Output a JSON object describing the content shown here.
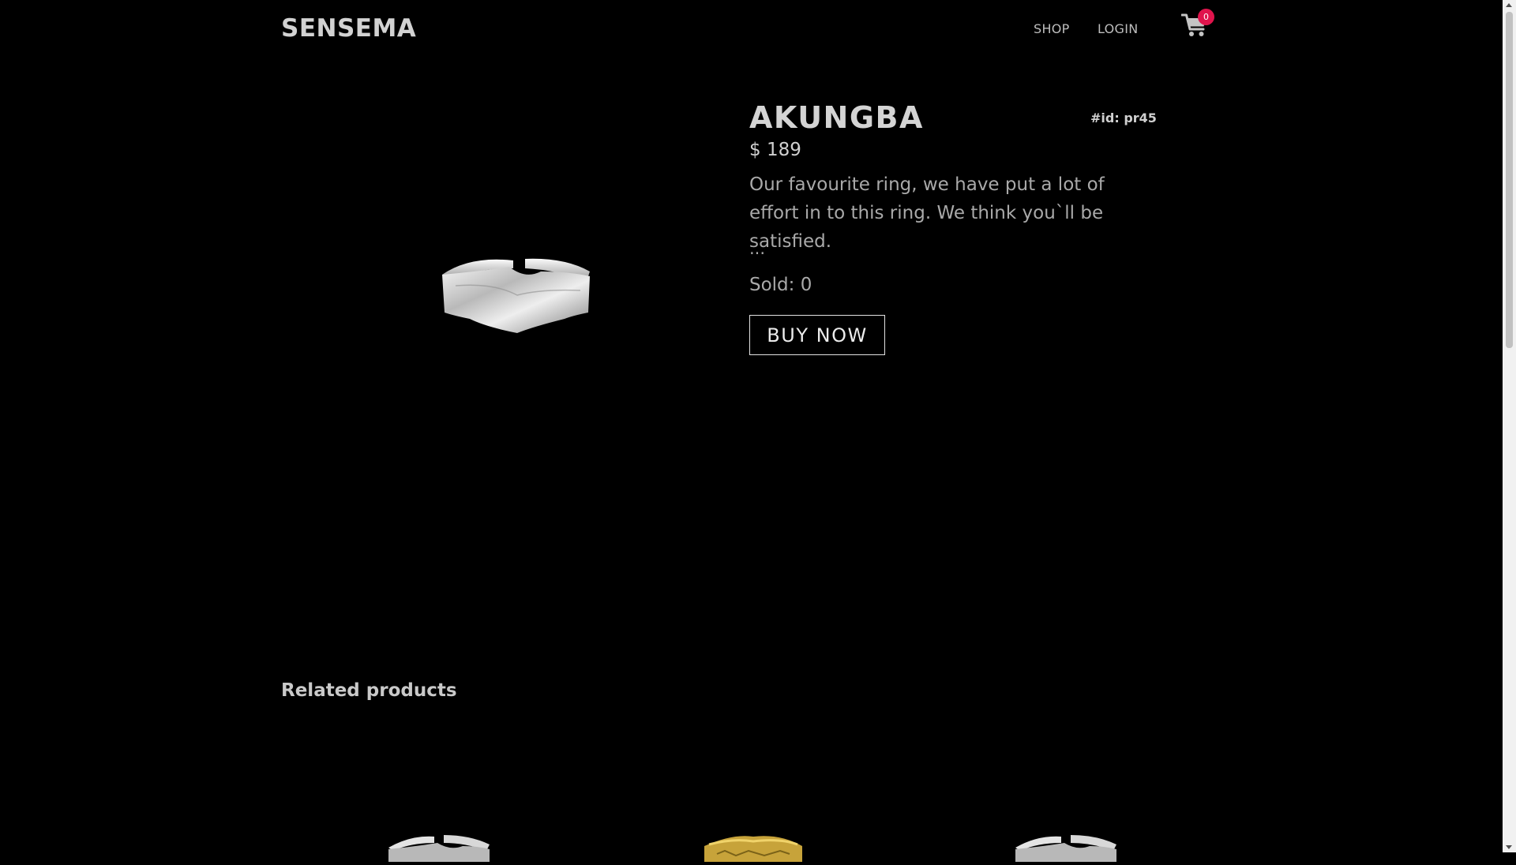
{
  "header": {
    "brand": "SENSEMA",
    "nav": {
      "shop": "SHOP",
      "login": "LOGIN"
    },
    "cart": {
      "icon": "cart-icon",
      "count": "0",
      "badge_color": "#e0144c"
    }
  },
  "product": {
    "title": "AKUNGBA",
    "id_label": "#id: pr45",
    "price": "$ 189",
    "description": "Our favourite ring, we have put a lot of effort in to this ring. We think you`ll be satisfied.",
    "ellipsis": "...",
    "sold": "Sold: 0",
    "buy_label": "BUY NOW",
    "image": "silver-ring-image"
  },
  "related": {
    "title": "Related products",
    "items": [
      {
        "image": "silver-ring-image"
      },
      {
        "image": "gold-ring-image"
      },
      {
        "image": "silver-ring-image"
      }
    ]
  },
  "colors": {
    "background": "#000000",
    "accent": "#e0144c"
  }
}
